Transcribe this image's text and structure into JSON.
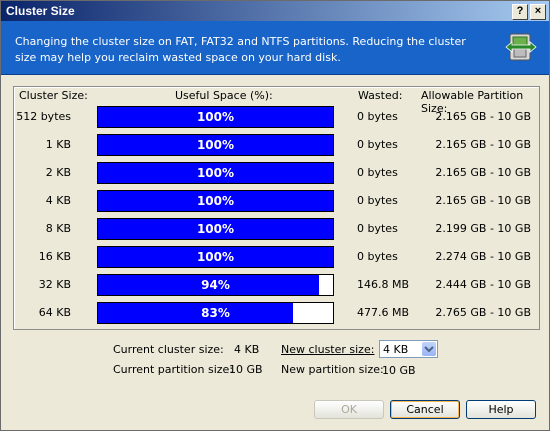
{
  "window": {
    "title": "Cluster Size",
    "help_glyph": "?",
    "close_glyph": "×"
  },
  "header": {
    "description": "Changing the cluster size on FAT, FAT32 and NTFS partitions. Reducing the cluster size may help you reclaim wasted space on your hard disk.",
    "icon": "disk-resize-icon"
  },
  "table": {
    "headers": {
      "cluster_size": "Cluster Size:",
      "useful_space": "Useful Space (%):",
      "wasted": "Wasted:",
      "allowable": "Allowable Partition Size:"
    },
    "rows": [
      {
        "cluster": "512 bytes",
        "useful": "100%",
        "useful_pct": 100,
        "wasted": "0 bytes",
        "range": "2.165 GB - 10 GB"
      },
      {
        "cluster": "1 KB",
        "useful": "100%",
        "useful_pct": 100,
        "wasted": "0 bytes",
        "range": "2.165 GB - 10 GB"
      },
      {
        "cluster": "2 KB",
        "useful": "100%",
        "useful_pct": 100,
        "wasted": "0 bytes",
        "range": "2.165 GB - 10 GB"
      },
      {
        "cluster": "4 KB",
        "useful": "100%",
        "useful_pct": 100,
        "wasted": "0 bytes",
        "range": "2.165 GB - 10 GB"
      },
      {
        "cluster": "8 KB",
        "useful": "100%",
        "useful_pct": 100,
        "wasted": "0 bytes",
        "range": "2.199 GB - 10 GB"
      },
      {
        "cluster": "16 KB",
        "useful": "100%",
        "useful_pct": 100,
        "wasted": "0 bytes",
        "range": "2.274 GB - 10 GB"
      },
      {
        "cluster": "32 KB",
        "useful": "94%",
        "useful_pct": 94,
        "wasted": "146.8 MB",
        "range": "2.444 GB - 10 GB"
      },
      {
        "cluster": "64 KB",
        "useful": "83%",
        "useful_pct": 83,
        "wasted": "477.6 MB",
        "range": "2.765 GB - 10 GB"
      }
    ]
  },
  "info": {
    "current_cluster_label": "Current cluster size:",
    "current_cluster_value": "4 KB",
    "current_partition_label": "Current partition size:",
    "current_partition_value": "10 GB",
    "new_cluster_label": "New cluster size:",
    "new_cluster_value": "4 KB",
    "new_partition_label": "New partition size:",
    "new_partition_value": "10 GB"
  },
  "buttons": {
    "ok": "OK",
    "cancel": "Cancel",
    "help": "Help"
  },
  "colors": {
    "bar_fill": "#0000ff",
    "header_bg": "#1864c8"
  }
}
